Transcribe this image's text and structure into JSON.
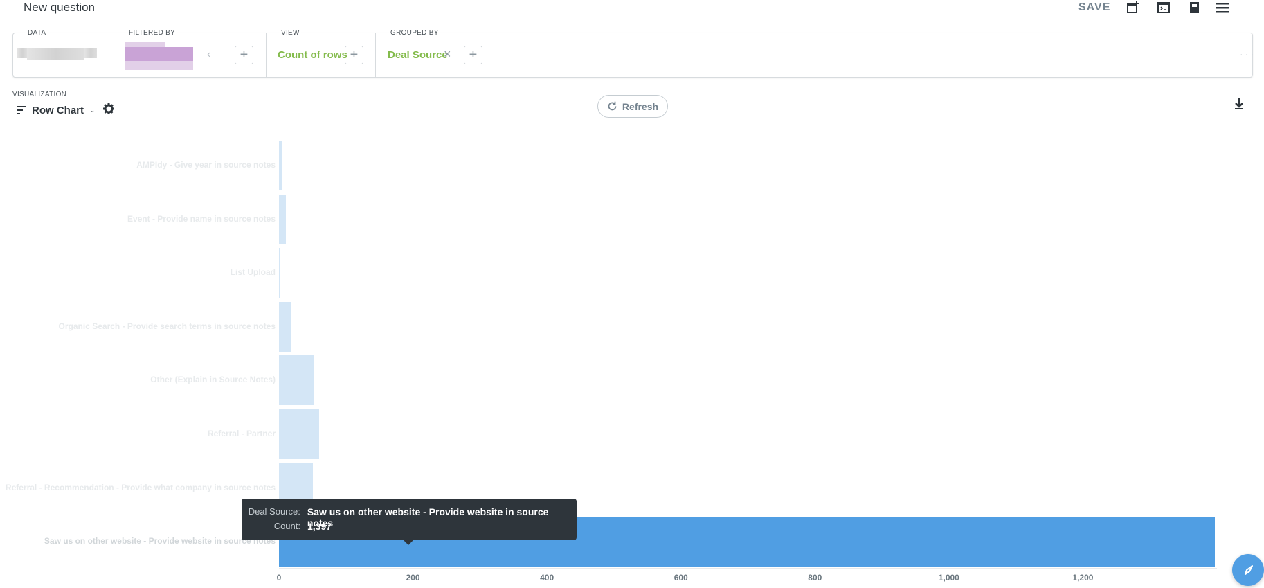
{
  "header": {
    "title": "New question",
    "save_label": "SAVE",
    "icons": [
      "add-to-dashboard-icon",
      "sql-icon",
      "notebook-icon",
      "menu-icon"
    ]
  },
  "query_bar": {
    "data_label": "DATA",
    "filtered_by_label": "FILTERED BY",
    "view_label": "VIEW",
    "view_metric": "Count of rows",
    "grouped_by_label": "GROUPED BY",
    "grouped_by_value": "Deal Source",
    "more_icon": "ellipsis-icon"
  },
  "visualization": {
    "label": "VISUALIZATION",
    "type": "Row Chart",
    "refresh_label": "Refresh"
  },
  "chart_data": {
    "type": "bar",
    "orientation": "horizontal",
    "categories": [
      "AMPIdy - Give year in source notes",
      "Event - Provide name in source notes",
      "List Upload",
      "Organic Search - Provide search terms in source notes",
      "Other (Explain in Source Notes)",
      "Referral - Partner",
      "Referral - Recommendation - Provide what company in source notes",
      "Saw us on other website - Provide website in source notes"
    ],
    "values": [
      5,
      10,
      1,
      18,
      52,
      60,
      51,
      1397
    ],
    "xlim": [
      0,
      1400
    ],
    "xticks": [
      "0",
      "200",
      "400",
      "600",
      "800",
      "1,000",
      "1,200"
    ],
    "highlighted_index": 7,
    "colors": {
      "bar": "#d4e6f6",
      "highlight": "#509ee3"
    }
  },
  "tooltip": {
    "source_key": "Deal Source:",
    "source_value": "Saw us on other website - Provide website in source notes",
    "count_key": "Count:",
    "count_value": "1,397"
  }
}
